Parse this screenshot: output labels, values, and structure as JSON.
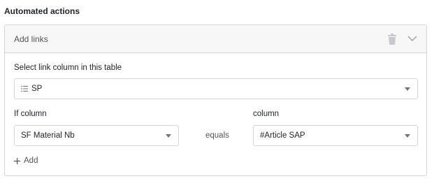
{
  "section": {
    "title": "Automated actions"
  },
  "action": {
    "title": "Add links",
    "link_column_label": "Select link column in this table",
    "link_column_value": "SP",
    "if_column_label": "If column",
    "if_column_value": "SF Material Nb",
    "operator": "equals",
    "column_label": "column",
    "column_value": "#Article SAP",
    "add_label": "Add"
  },
  "icons": {
    "delete": "trash-icon",
    "collapse": "chevron-down-icon",
    "link_column": "list-icon",
    "add": "plus-icon",
    "dropdown": "caret-down-icon"
  }
}
